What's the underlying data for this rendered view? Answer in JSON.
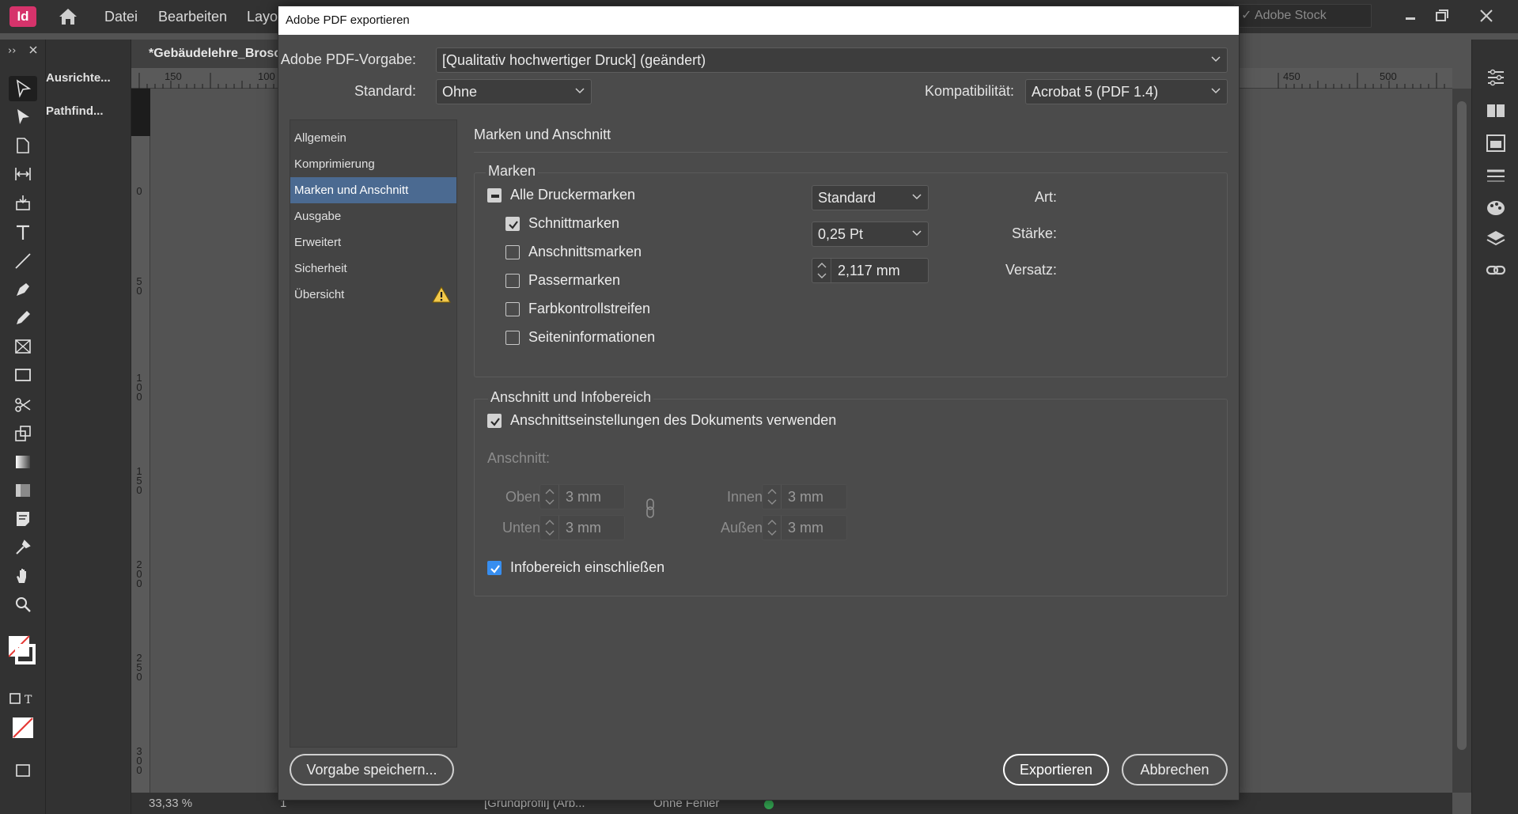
{
  "app": {
    "logo": "Id",
    "menu": [
      "Datei",
      "Bearbeiten",
      "Layo"
    ],
    "stock_search": "Adobe Stock",
    "panels": [
      "Ausrichte...",
      "Pathfind..."
    ],
    "doc_tab": "*Gebäudelehre_Brosc",
    "ruler_top_labels": [
      "150",
      "100",
      "450",
      "500"
    ],
    "ruler_left_labels": [
      "0",
      "50",
      "100",
      "150",
      "200",
      "250",
      "300"
    ],
    "status": {
      "zoom": "33,33 %",
      "page": "1",
      "profile": "[Grundprofil] (Arb...",
      "preflight": "Ohne Fehler"
    },
    "dock_icons": [
      "properties-icon",
      "pages-icon",
      "cc-libraries-icon",
      "stroke-icon",
      "swatches-icon",
      "layers-icon",
      "links-icon"
    ]
  },
  "dialog": {
    "title": "Adobe PDF exportieren",
    "preset_label": "Adobe PDF-Vorgabe:",
    "preset_value": "[Qualitativ hochwertiger Druck] (geändert)",
    "standard_label": "Standard:",
    "standard_value": "Ohne",
    "compat_label": "Kompatibilität:",
    "compat_value": "Acrobat 5 (PDF 1.4)",
    "nav": [
      {
        "label": "Allgemein",
        "active": false
      },
      {
        "label": "Komprimierung",
        "active": false
      },
      {
        "label": "Marken und Anschnitt",
        "active": true
      },
      {
        "label": "Ausgabe",
        "active": false
      },
      {
        "label": "Erweitert",
        "active": false
      },
      {
        "label": "Sicherheit",
        "active": false
      },
      {
        "label": "Übersicht",
        "active": false,
        "warning": true
      }
    ],
    "section_title": "Marken und Anschnitt",
    "marks": {
      "group_label": "Marken",
      "all_label": "Alle Druckermarken",
      "items": [
        {
          "label": "Schnittmarken",
          "checked": true
        },
        {
          "label": "Anschnittsmarken",
          "checked": false
        },
        {
          "label": "Passermarken",
          "checked": false
        },
        {
          "label": "Farbkontrollstreifen",
          "checked": false
        },
        {
          "label": "Seiteninformationen",
          "checked": false
        }
      ],
      "type_label": "Art:",
      "type_value": "Standard",
      "weight_label": "Stärke:",
      "weight_value": "0,25 Pt",
      "offset_label": "Versatz:",
      "offset_value": "2,117 mm"
    },
    "bleed": {
      "group_label": "Anschnitt und Infobereich",
      "use_doc_label": "Anschnittseinstellungen des Dokuments verwenden",
      "use_doc_checked": true,
      "bleed_label": "Anschnitt:",
      "top_label": "Oben:",
      "top_value": "3 mm",
      "bottom_label": "Unten:",
      "bottom_value": "3 mm",
      "inside_label": "Innen:",
      "inside_value": "3 mm",
      "outside_label": "Außen:",
      "outside_value": "3 mm",
      "slug_label": "Infobereich einschließen",
      "slug_checked": true
    },
    "buttons": {
      "save_preset": "Vorgabe speichern...",
      "export": "Exportieren",
      "cancel": "Abbrechen"
    }
  }
}
